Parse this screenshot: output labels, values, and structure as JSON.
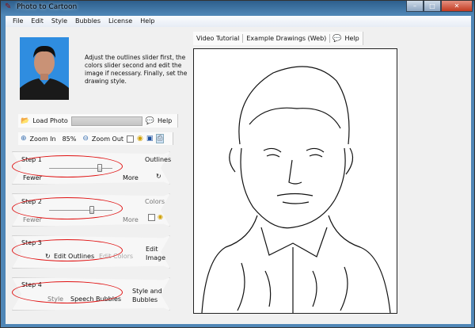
{
  "window": {
    "title": "Photo to Cartoon",
    "controls": [
      "minimize",
      "maximize",
      "close"
    ]
  },
  "menu": [
    "File",
    "Edit",
    "Style",
    "Bubbles",
    "License",
    "Help"
  ],
  "description": "Adjust the outlines slider first, the colors slider second and edit the image if necessary. Finally, set the drawing style.",
  "toolbar1": {
    "load_photo": "Load Photo",
    "help": "Help",
    "progress": 0
  },
  "toolbar2": {
    "zoom_in": "Zoom In",
    "zoom_level": "85%",
    "zoom_out": "Zoom Out"
  },
  "steps": [
    {
      "label": "Step 1",
      "title": "Outlines",
      "fewer": "Fewer",
      "more": "More",
      "slider_value": 0.82
    },
    {
      "label": "Step 2",
      "title": "Colors",
      "fewer": "Fewer",
      "more": "More",
      "slider_value": 0.67
    },
    {
      "label": "Step 3",
      "title": "Edit Image",
      "edit_outlines": "Edit Outlines",
      "edit_colors": "Edit Colors"
    },
    {
      "label": "Step 4",
      "title": "Style and Bubbles",
      "style": "Style",
      "speech_bubbles": "Speech Bubbles"
    }
  ],
  "links": {
    "video": "Video Tutorial",
    "examples": "Example Drawings (Web)",
    "help": "Help"
  },
  "colors": {
    "highlight": "#e01010"
  }
}
